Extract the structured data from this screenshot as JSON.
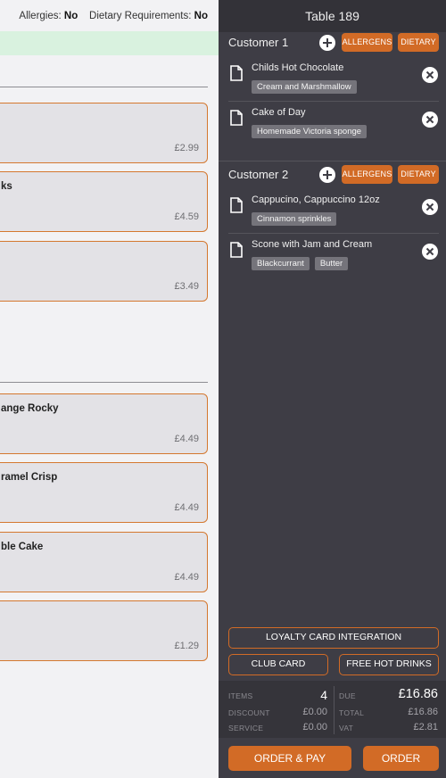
{
  "menu": {
    "allergies_label": "Allergies:",
    "allergies_value": "No",
    "dietary_label": "Dietary Requirements:",
    "dietary_value": "No",
    "items": [
      {
        "name": "",
        "price": "£2.99"
      },
      {
        "name": "ks",
        "price": "£4.59"
      },
      {
        "name": "",
        "price": "£3.49"
      },
      {
        "name": "ange Rocky",
        "price": "£4.49"
      },
      {
        "name": "ramel Crisp",
        "price": "£4.49"
      },
      {
        "name": "ble Cake",
        "price": "£4.49"
      },
      {
        "name": "",
        "price": "£1.29"
      }
    ]
  },
  "order": {
    "table_title": "Table 189",
    "allergens_label": "ALLERGENS",
    "dietary_label": "DIETARY",
    "customers": [
      {
        "name": "Customer 1",
        "lines": [
          {
            "name": "Childs Hot Chocolate",
            "mods": [
              "Cream and Marshmallow"
            ]
          },
          {
            "name": "Cake of Day",
            "mods": [
              "Homemade Victoria sponge"
            ]
          }
        ]
      },
      {
        "name": "Customer 2",
        "lines": [
          {
            "name": "Cappucino, Cappuccino 12oz",
            "mods": [
              "Cinnamon sprinkles"
            ]
          },
          {
            "name": "Scone with Jam and Cream",
            "mods": [
              "Blackcurrant",
              "Butter"
            ]
          }
        ]
      }
    ],
    "loyalty_label": "LOYALTY CARD INTEGRATION",
    "club_card_label": "CLUB CARD",
    "free_drinks_label": "FREE HOT DRINKS",
    "totals": {
      "items_label": "ITEMS",
      "items_value": "4",
      "discount_label": "DISCOUNT",
      "discount_value": "£0.00",
      "service_label": "SERVICE",
      "service_value": "£0.00",
      "due_label": "DUE",
      "due_value": "£16.86",
      "total_label": "TOTAL",
      "total_value": "£16.86",
      "vat_label": "VAT",
      "vat_value": "£2.81"
    },
    "order_pay_label": "ORDER & PAY",
    "order_label": "ORDER"
  },
  "colors": {
    "accent": "#d26b26",
    "panel": "#3e3d45",
    "card": "#e3e2e6",
    "card_border": "#d4782f",
    "info_band": "#d9f2df"
  }
}
